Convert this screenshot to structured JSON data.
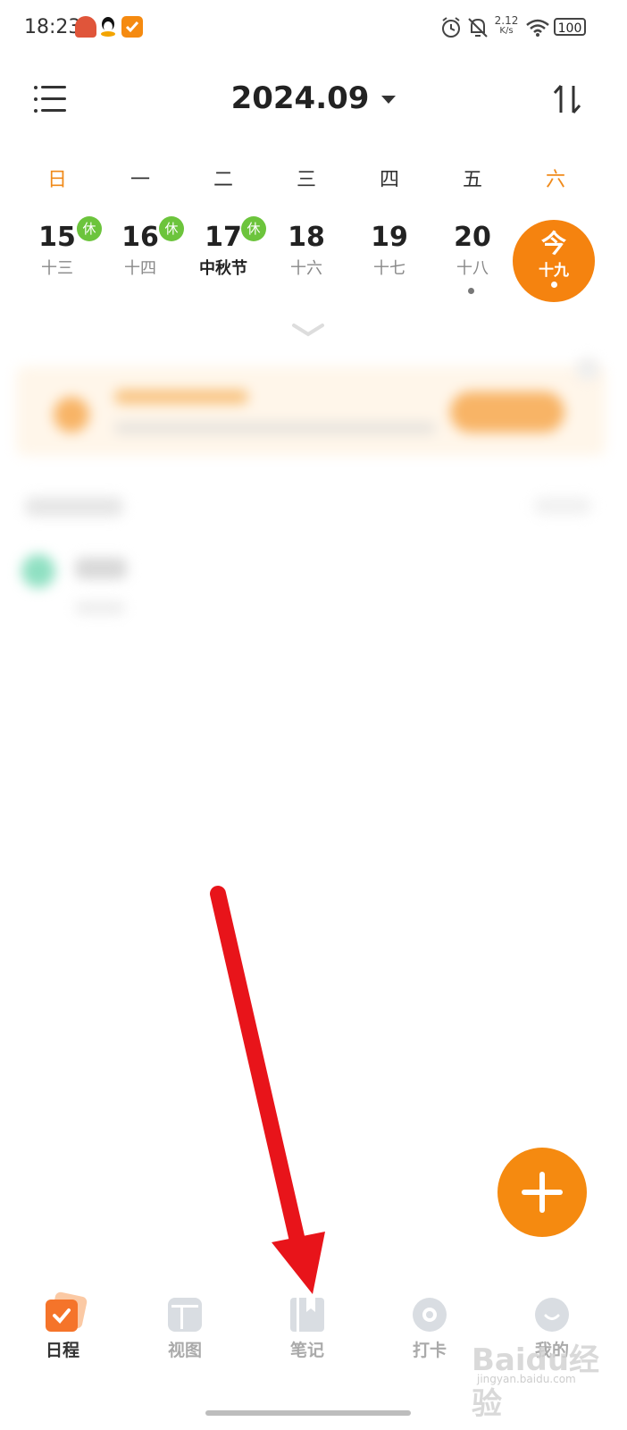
{
  "status_bar": {
    "time": "18:23",
    "net_speed_value": "2.12",
    "net_speed_unit": "K/s",
    "battery": "100",
    "icons": [
      "app-icon",
      "qq-icon",
      "check-icon",
      "alarm-icon",
      "mute-icon",
      "wifi-icon",
      "battery-icon"
    ]
  },
  "header": {
    "title": "2024.09"
  },
  "weekdays": [
    "日",
    "一",
    "二",
    "三",
    "四",
    "五",
    "六"
  ],
  "days": [
    {
      "num": "15",
      "lunar": "十三",
      "rest": "休"
    },
    {
      "num": "16",
      "lunar": "十四",
      "rest": "休"
    },
    {
      "num": "17",
      "lunar": "中秋节",
      "rest": "休"
    },
    {
      "num": "18",
      "lunar": "十六"
    },
    {
      "num": "19",
      "lunar": "十七"
    },
    {
      "num": "20",
      "lunar": "十八"
    }
  ],
  "today": {
    "num": "今",
    "lunar": "十九"
  },
  "tabs": [
    {
      "label": "日程"
    },
    {
      "label": "视图"
    },
    {
      "label": "笔记"
    },
    {
      "label": "打卡"
    },
    {
      "label": "我的"
    }
  ],
  "fab_label": "+",
  "watermark": {
    "main": "Baidu经验",
    "sub": "jingyan.baidu.com"
  },
  "colors": {
    "accent": "#f5830f",
    "rest_badge": "#6cc43c",
    "arrow": "#e8141a"
  }
}
